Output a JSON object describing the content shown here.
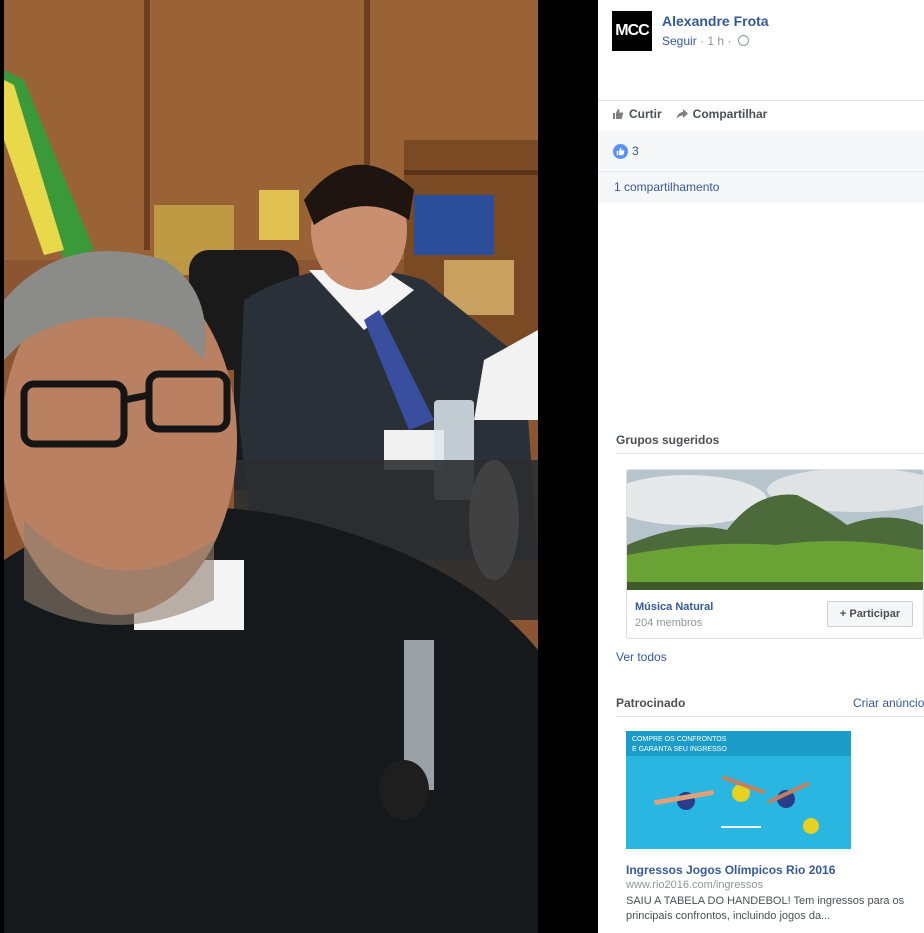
{
  "post": {
    "author": "Alexandre Frota",
    "avatar_text": "MCC",
    "follow_label": "Seguir",
    "time": "1 h",
    "separator": "·",
    "privacy_icon": "globe-icon"
  },
  "actions": {
    "like_label": "Curtir",
    "share_label": "Compartilhar"
  },
  "reactions": {
    "like_count": "3",
    "shares_text": "1 compartilhamento"
  },
  "suggested_groups": {
    "title": "Grupos sugeridos",
    "group_name": "Música Natural",
    "members": "204 membros",
    "join_label": "+ Participar",
    "see_all": "Ver todos"
  },
  "sponsored": {
    "title": "Patrocinado",
    "create_ad": "Criar anúncio",
    "banner_text_1": "COMPRE OS CONFRONTOS",
    "banner_text_2": "E GARANTA SEU INGRESSO",
    "ad_title": "Ingressos Jogos Olímpicos Rio 2016",
    "ad_url": "www.rio2016.com/ingressos",
    "ad_desc": "SAIU A TABELA DO HANDEBOL! Tem ingressos para os principais confrontos, incluindo jogos da..."
  },
  "colors": {
    "link": "#365899",
    "like_blue": "#5890ff",
    "ad_bg": "#29b6e0"
  }
}
